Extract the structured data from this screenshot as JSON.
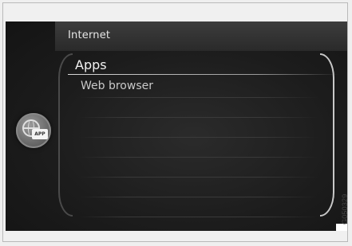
{
  "header": {
    "title": "Internet"
  },
  "menu": {
    "items": [
      {
        "label": "Apps",
        "selected": true
      },
      {
        "label": "Web browser",
        "selected": false
      }
    ]
  },
  "side_button": {
    "icon": "globe-app-icon",
    "badge_label": "APP"
  },
  "figure_code": "G050329",
  "colors": {
    "screen_bg": "#1c1c1c",
    "text": "#e8e8e8",
    "frame": "#f0f0f0"
  }
}
